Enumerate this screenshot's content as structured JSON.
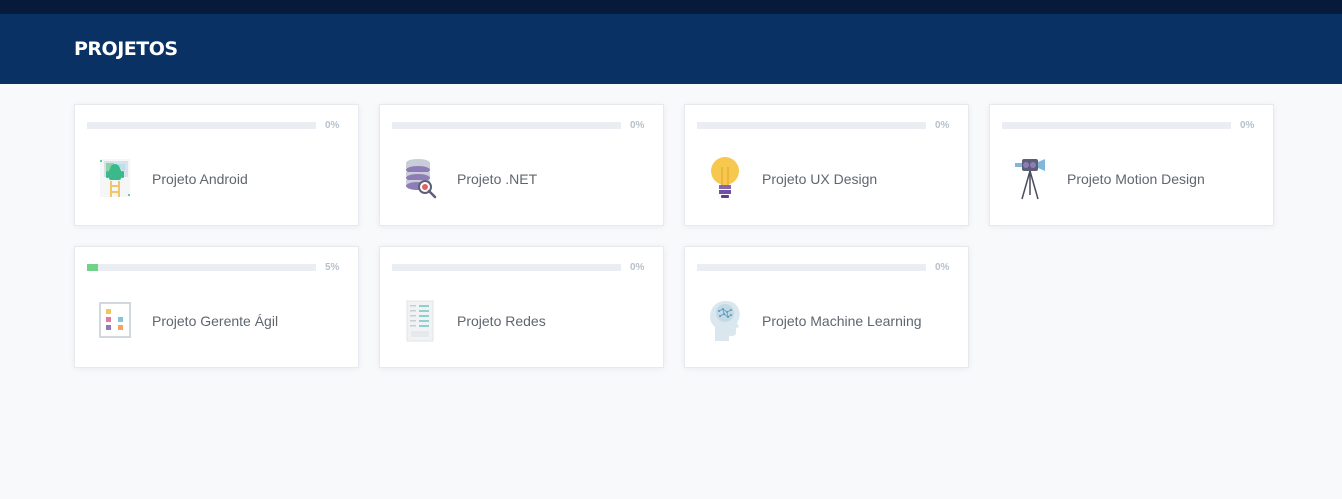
{
  "header": {
    "title": "PROJETOS"
  },
  "projects": [
    {
      "name": "Projeto Android",
      "progress": 0,
      "progress_label": "0%",
      "icon": "android-robot-icon"
    },
    {
      "name": "Projeto .NET",
      "progress": 0,
      "progress_label": "0%",
      "icon": "database-search-icon"
    },
    {
      "name": "Projeto UX Design",
      "progress": 0,
      "progress_label": "0%",
      "icon": "lightbulb-icon"
    },
    {
      "name": "Projeto Motion Design",
      "progress": 0,
      "progress_label": "0%",
      "icon": "video-camera-tripod-icon"
    },
    {
      "name": "Projeto Gerente Ágil",
      "progress": 5,
      "progress_label": "5%",
      "icon": "kanban-board-icon"
    },
    {
      "name": "Projeto Redes",
      "progress": 0,
      "progress_label": "0%",
      "icon": "server-rack-icon"
    },
    {
      "name": "Projeto Machine Learning",
      "progress": 0,
      "progress_label": "0%",
      "icon": "brain-head-icon"
    }
  ],
  "colors": {
    "header": "#0a3164",
    "top_strip": "#061a3a",
    "progress_fill": "#6fd286",
    "progress_track": "#eaedf1"
  }
}
